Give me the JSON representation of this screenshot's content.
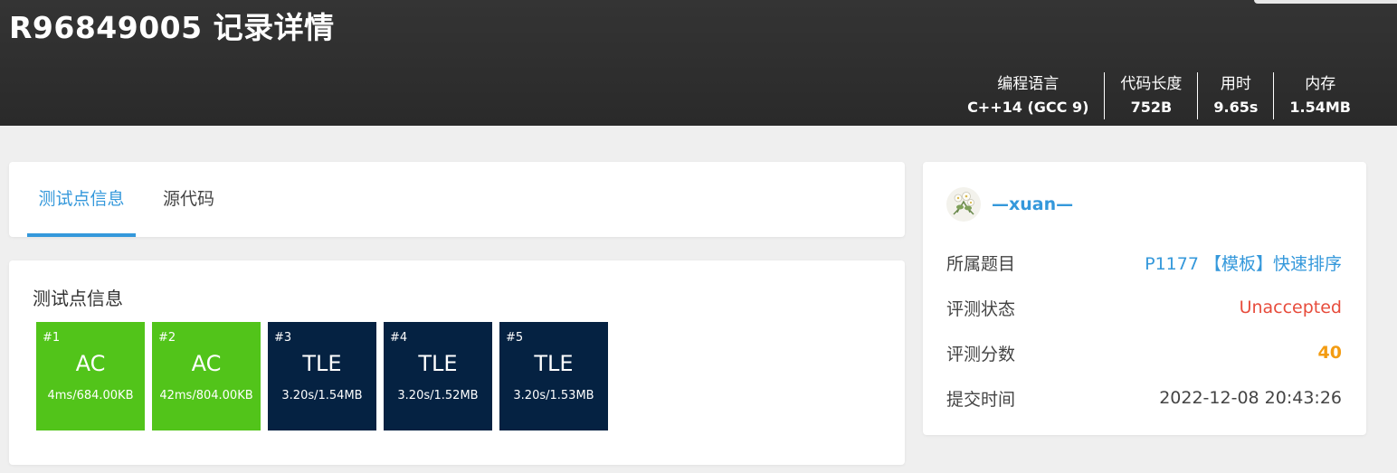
{
  "header": {
    "title": "R96849005 记录详情",
    "stats": [
      {
        "label": "编程语言",
        "value": "C++14 (GCC 9)"
      },
      {
        "label": "代码长度",
        "value": "752B"
      },
      {
        "label": "用时",
        "value": "9.65s"
      },
      {
        "label": "内存",
        "value": "1.54MB"
      }
    ]
  },
  "tabs": {
    "testcases": "测试点信息",
    "source": "源代码"
  },
  "testcases": {
    "title": "测试点信息",
    "items": [
      {
        "num": "#1",
        "status": "AC",
        "detail": "4ms/684.00KB",
        "color": "#52c41a"
      },
      {
        "num": "#2",
        "status": "AC",
        "detail": "42ms/804.00KB",
        "color": "#52c41a"
      },
      {
        "num": "#3",
        "status": "TLE",
        "detail": "3.20s/1.54MB",
        "color": "#052242"
      },
      {
        "num": "#4",
        "status": "TLE",
        "detail": "3.20s/1.52MB",
        "color": "#052242"
      },
      {
        "num": "#5",
        "status": "TLE",
        "detail": "3.20s/1.53MB",
        "color": "#052242"
      }
    ]
  },
  "sidebar": {
    "username": "—xuan—",
    "rows": [
      {
        "key": "所属题目",
        "value": "P1177 【模板】快速排序"
      },
      {
        "key": "评测状态",
        "value": "Unaccepted"
      },
      {
        "key": "评测分数",
        "value": "40"
      },
      {
        "key": "提交时间",
        "value": "2022-12-08 20:43:26"
      }
    ]
  },
  "colors": {
    "accent": "#3498db",
    "ac": "#52c41a",
    "tle": "#052242",
    "unaccepted": "#e74c3c",
    "score": "#f39c12"
  }
}
